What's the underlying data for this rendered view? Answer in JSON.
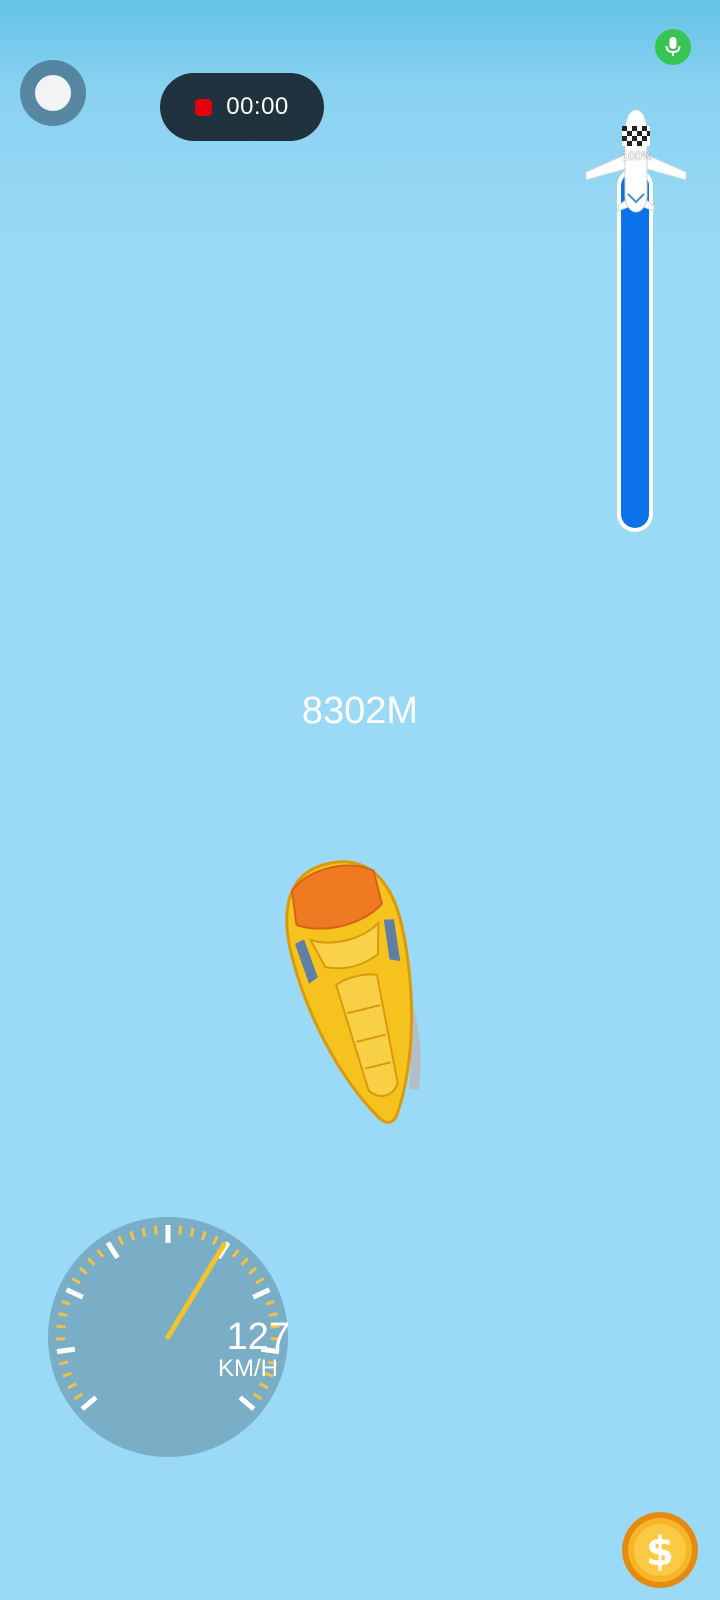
{
  "recording": {
    "time": "00:00"
  },
  "progress": {
    "percent_label": "100%",
    "fill_fraction": 1.0
  },
  "distance": {
    "label": "8302M"
  },
  "speedometer": {
    "value": "127",
    "unit": "KM/H",
    "needle_fraction": 0.62
  },
  "colors": {
    "sky": "#9bdaf6",
    "progress_fill": "#0b72ea",
    "record_dot": "#e3000f",
    "mic": "#37c552",
    "car_body": "#f6c21d",
    "car_roof": "#f07a22",
    "coin": "#f4a81c"
  },
  "icons": {
    "assist": "assistive-touch-icon",
    "mic": "microphone-icon",
    "plane": "airplane-icon",
    "flag": "checkered-flag-icon",
    "coin": "dollar-coin-icon"
  }
}
